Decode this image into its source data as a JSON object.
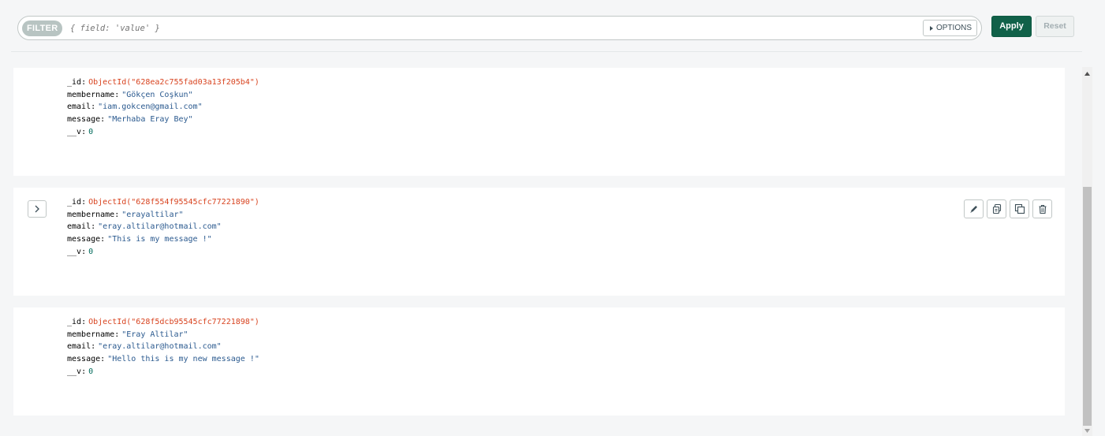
{
  "filter": {
    "label": "FILTER",
    "placeholder": "{ field: 'value' }",
    "options_label": "OPTIONS"
  },
  "buttons": {
    "apply": "Apply",
    "reset": "Reset"
  },
  "documents": [
    {
      "id_key": "_id",
      "id_value": "ObjectId(\"628ea2c755fad03a13f205b4\")",
      "membername_key": "membername",
      "membername_value": "\"Gökçen Coşkun\"",
      "email_key": "email",
      "email_value": "\"iam.gokcen@gmail.com\"",
      "message_key": "message",
      "message_value": "\"Merhaba Eray Bey\"",
      "v_key": "__v",
      "v_value": "0"
    },
    {
      "id_key": "_id",
      "id_value": "ObjectId(\"628f554f95545cfc77221890\")",
      "membername_key": "membername",
      "membername_value": "\"erayaltilar\"",
      "email_key": "email",
      "email_value": "\"eray.altilar@hotmail.com\"",
      "message_key": "message",
      "message_value": "\"This is my message !\"",
      "v_key": "__v",
      "v_value": "0"
    },
    {
      "id_key": "_id",
      "id_value": "ObjectId(\"628f5dcb95545cfc77221898\")",
      "membername_key": "membername",
      "membername_value": "\"Eray Altilar\"",
      "email_key": "email",
      "email_value": "\"eray.altilar@hotmail.com\"",
      "message_key": "message",
      "message_value": "\"Hello this is my new message !\"",
      "v_key": "__v",
      "v_value": "0"
    }
  ],
  "icons": {
    "expand": "chevron-right-icon",
    "edit": "pencil-icon",
    "copy": "clipboard-copy-icon",
    "clone": "clone-icon",
    "delete": "trash-icon"
  },
  "colors": {
    "apply_bg": "#116149",
    "objectid": "#d8431f",
    "string": "#2b5a8f",
    "number": "#00695a"
  }
}
